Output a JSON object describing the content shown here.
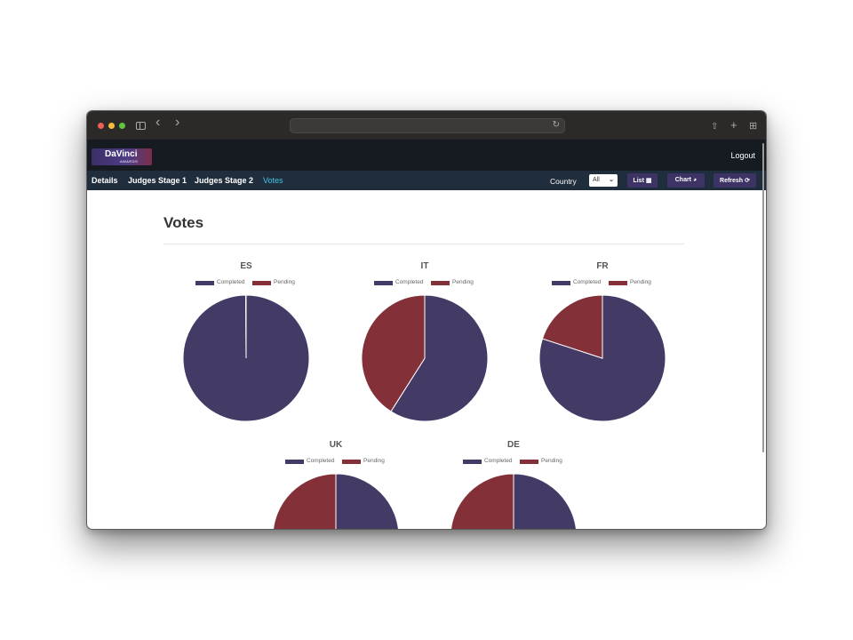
{
  "browser": {
    "back_glyph": "‹",
    "forward_glyph": "›",
    "reload_glyph": "↻",
    "share_glyph": "⇧",
    "newtab_glyph": "+",
    "tabs_glyph": "⊞"
  },
  "header": {
    "logo": {
      "main": "DaVinci",
      "sub": "AWARDS"
    },
    "logout_label": "Logout"
  },
  "subnav": {
    "links": [
      "Details",
      "Judges Stage 1",
      "Judges Stage 2",
      "Votes"
    ],
    "active": "Votes",
    "country_label": "Country",
    "country_value": "All",
    "list_label": "List",
    "list_icon": "▦",
    "chart_label": "Chart",
    "chart_icon": "◕",
    "refresh_label": "Refresh",
    "refresh_icon": "⟳"
  },
  "page": {
    "title": "Votes"
  },
  "colors": {
    "completed": "#443a66",
    "pending": "#843038"
  },
  "chart_data": [
    {
      "type": "pie",
      "title": "ES",
      "labels": [
        "Completed",
        "Pending"
      ],
      "values": [
        1000,
        1
      ]
    },
    {
      "type": "pie",
      "title": "IT",
      "labels": [
        "Completed",
        "Pending"
      ],
      "values": [
        59,
        41
      ]
    },
    {
      "type": "pie",
      "title": "FR",
      "labels": [
        "Completed",
        "Pending"
      ],
      "values": [
        80,
        20
      ]
    },
    {
      "type": "pie",
      "title": "UK",
      "labels": [
        "Completed",
        "Pending"
      ],
      "values": [
        50,
        50
      ]
    },
    {
      "type": "pie",
      "title": "DE",
      "labels": [
        "Completed",
        "Pending"
      ],
      "values": [
        50,
        50
      ]
    }
  ]
}
